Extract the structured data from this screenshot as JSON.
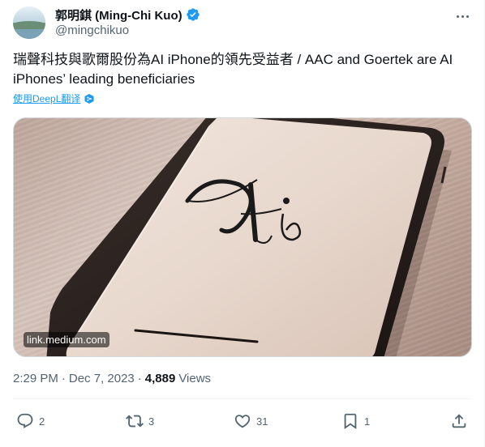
{
  "author": {
    "display_name": "郭明錤 (Ming-Chi Kuo)",
    "handle": "@mingchikuo",
    "verified": true,
    "avatar_icon": "landscape-avatar"
  },
  "tweet": {
    "text": "瑞聲科技與歌爾股份為AI iPhone的領先受益者 / AAC and Goertek are AI iPhones’ leading beneficiaries",
    "translate_label": "使用DeepL翻译",
    "media": {
      "domain": "link.medium.com",
      "image_text": "Ai"
    }
  },
  "meta": {
    "time": "2:29 PM",
    "separator1": "·",
    "date": "Dec 7, 2023",
    "separator2": "·",
    "views_count": "4,889",
    "views_label": "Views"
  },
  "actions": {
    "reply_count": "2",
    "retweet_count": "3",
    "like_count": "31",
    "bookmark_count": "1"
  },
  "colors": {
    "accent": "#1d9bf0",
    "text": "#0f1419",
    "secondary": "#536471",
    "border": "#eff3f4"
  }
}
